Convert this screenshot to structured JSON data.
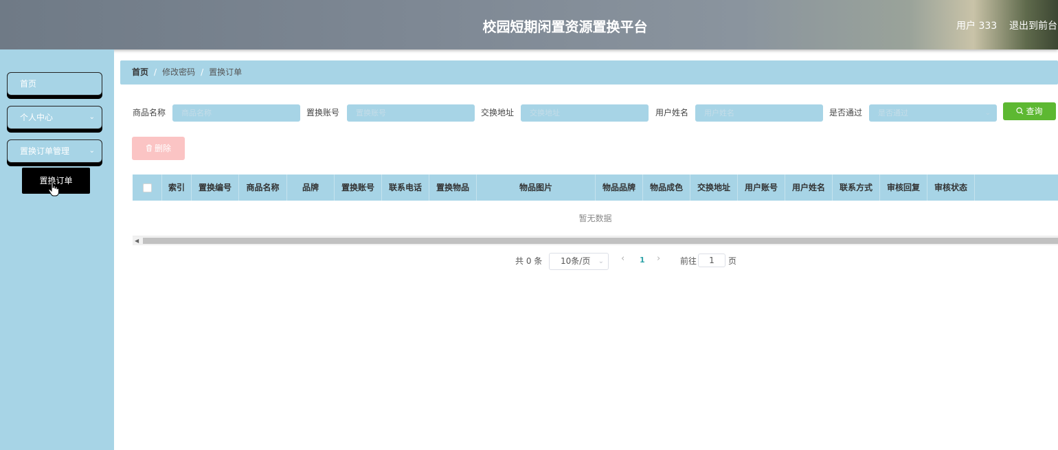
{
  "header": {
    "title": "校园短期闲置资源置换平台",
    "user": "用户 333",
    "logout": "退出到前台"
  },
  "sidebar": {
    "items": [
      {
        "label": "首页"
      },
      {
        "label": "个人中心"
      },
      {
        "label": "置换订单管理"
      }
    ],
    "submenu": {
      "label": "置换订单"
    }
  },
  "breadcrumb": {
    "home": "首页",
    "items": [
      "修改密码",
      "置换订单"
    ],
    "separator": "/"
  },
  "search": {
    "fields": [
      {
        "label": "商品名称",
        "placeholder": "商品名称"
      },
      {
        "label": "置换账号",
        "placeholder": "置换账号"
      },
      {
        "label": "交换地址",
        "placeholder": "交换地址"
      },
      {
        "label": "用户姓名",
        "placeholder": "用户姓名"
      },
      {
        "label": "是否通过",
        "placeholder": "是否通过"
      }
    ],
    "search_label": "查询",
    "delete_label": "删除"
  },
  "table": {
    "columns": [
      "索引",
      "置换编号",
      "商品名称",
      "品牌",
      "置换账号",
      "联系电话",
      "置换物品",
      "物品图片",
      "物品品牌",
      "物品成色",
      "交换地址",
      "用户账号",
      "用户姓名",
      "联系方式",
      "审核回复",
      "审核状态"
    ],
    "empty_text": "暂无数据"
  },
  "pagination": {
    "total": "共 0 条",
    "page_size": "10条/页",
    "current_page": "1",
    "goto_label": "前往",
    "goto_value": "1",
    "page_suffix": "页"
  },
  "colors": {
    "accent": "#a7d4e6",
    "search_button": "#5db832",
    "delete_button": "#fbc4c4",
    "active_page": "#2fa3a8"
  }
}
